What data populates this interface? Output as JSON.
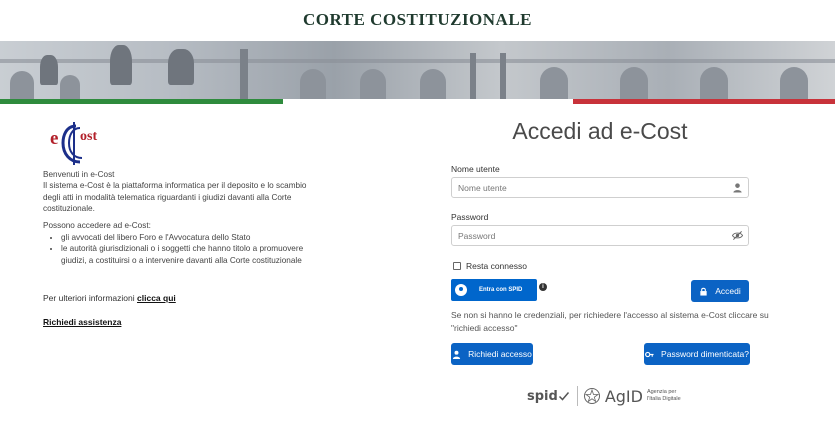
{
  "header": {
    "title": "CORTE COSTITUZIONALE"
  },
  "colors": {
    "primary_button": "#0b63c4",
    "spid_button": "#0066cc",
    "flag_green": "#2e8b3d",
    "flag_red": "#c8323a",
    "title": "#1f3a2e"
  },
  "logo": {
    "text": "eCost"
  },
  "intro": {
    "welcome": "Benvenuti in e-Cost",
    "description": "Il sistema e-Cost è la piattaforma informatica per il deposito e lo scambio degli atti in modalità telematica riguardanti i giudizi davanti alla Corte costituzionale.",
    "access_title": "Possono accedere ad e-Cost:",
    "access_items": [
      "gli avvocati del libero Foro e l'Avvocatura dello Stato",
      "le autorità giurisdizionali o i soggetti che hanno titolo a promuovere giudizi, a costituirsi o a intervenire davanti alla Corte costituzionale"
    ]
  },
  "more_info": {
    "text": "Per ulteriori informazioni",
    "link": "clicca qui"
  },
  "assistance": {
    "link": "Richiedi assistenza"
  },
  "login": {
    "title": "Accedi ad e-Cost",
    "username_label": "Nome utente",
    "username_placeholder": "Nome utente",
    "password_label": "Password",
    "password_placeholder": "Password",
    "remember_label": "Resta connesso",
    "spid_button": "Entra con SPID",
    "login_button": "Accedi",
    "note": "Se non si hanno le credenziali, per richiedere l'accesso al sistema e-Cost cliccare su \"richiedi accesso\"",
    "request_button": "Richiedi accesso",
    "forgot_button": "Password dimenticata?"
  },
  "footer_logos": {
    "spid": "spid",
    "agid": "AgID",
    "agid_sub1": "Agenzia per",
    "agid_sub2": "l'Italia Digitale"
  },
  "icons": {
    "user": "user-icon",
    "eye": "eye-icon",
    "lock": "lock-icon",
    "key": "key-icon",
    "info": "info-icon"
  }
}
